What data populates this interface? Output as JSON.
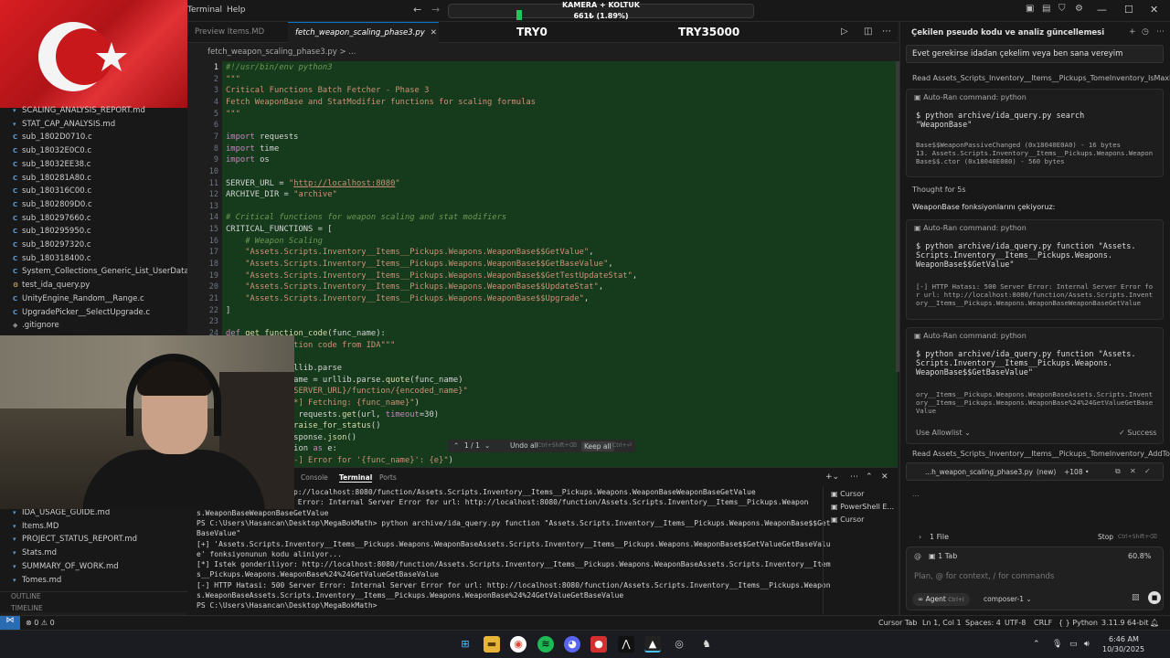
{
  "menu": {
    "terminal": "Terminal",
    "help": "Help"
  },
  "stream": {
    "label": "KAMERA + KOLTUK",
    "stat": "661₺ (1.89%)",
    "try0": "TRY0",
    "try35000": "TRY35000"
  },
  "tabs": {
    "preview": "Preview Items.MD",
    "active": "fetch_weapon_scaling_phase3.py"
  },
  "breadcrumb": "fetch_weapon_scaling_phase3.py  >  ...",
  "explorer": {
    "files_top": [
      {
        "icon": "md",
        "name": "SCALING_ANALYSIS_REPORT.md"
      },
      {
        "icon": "md",
        "name": "STAT_CAP_ANALYSIS.md"
      },
      {
        "icon": "c",
        "name": "sub_1802D0710.c"
      },
      {
        "icon": "c",
        "name": "sub_18032E0C0.c"
      },
      {
        "icon": "c",
        "name": "sub_18032EE38.c"
      },
      {
        "icon": "c",
        "name": "sub_180281A80.c"
      },
      {
        "icon": "c",
        "name": "sub_180316C00.c"
      },
      {
        "icon": "c",
        "name": "sub_1802809D0.c"
      },
      {
        "icon": "c",
        "name": "sub_180297660.c"
      },
      {
        "icon": "c",
        "name": "sub_180295950.c"
      },
      {
        "icon": "c",
        "name": "sub_180297320.c"
      },
      {
        "icon": "c",
        "name": "sub_180318400.c"
      },
      {
        "icon": "c",
        "name": "System_Collections_Generic_List_UserDataSt..."
      },
      {
        "icon": "py",
        "name": "test_ida_query.py"
      },
      {
        "icon": "c",
        "name": "UnityEngine_Random__Range.c"
      },
      {
        "icon": "c",
        "name": "UpgradePicker__SelectUpgrade.c"
      },
      {
        "icon": "git",
        "name": ".gitignore"
      }
    ],
    "files_bottom": [
      {
        "icon": "md",
        "name": "IDA_USAGE_GUIDE.md"
      },
      {
        "icon": "md",
        "name": "Items.MD"
      },
      {
        "icon": "md",
        "name": "PROJECT_STATUS_REPORT.md"
      },
      {
        "icon": "md",
        "name": "Stats.md"
      },
      {
        "icon": "md",
        "name": "SUMMARY_OF_WORK.md"
      },
      {
        "icon": "md",
        "name": "Tomes.md"
      }
    ],
    "outline": "OUTLINE",
    "timeline": "TIMELINE"
  },
  "editor": {
    "lines": [
      {
        "n": "1",
        "html": "<span class='cm'>#!/usr/bin/env python3</span>"
      },
      {
        "n": "2",
        "html": "<span class='st'>\"\"\"</span>"
      },
      {
        "n": "3",
        "html": "<span class='st'>Critical Functions Batch Fetcher - Phase 3</span>"
      },
      {
        "n": "4",
        "html": "<span class='st'>Fetch WeaponBase and StatModifier functions for scaling formulas</span>"
      },
      {
        "n": "5",
        "html": "<span class='st'>\"\"\"</span>"
      },
      {
        "n": "6",
        "html": ""
      },
      {
        "n": "7",
        "html": "<span class='kw'>import</span> requests"
      },
      {
        "n": "8",
        "html": "<span class='kw'>import</span> time"
      },
      {
        "n": "9",
        "html": "<span class='kw'>import</span> os"
      },
      {
        "n": "10",
        "html": ""
      },
      {
        "n": "11",
        "html": "SERVER_URL = <span class='st'>\"</span><span class='url'>http://localhost:8080</span><span class='st'>\"</span>"
      },
      {
        "n": "12",
        "html": "ARCHIVE_DIR = <span class='st'>\"archive\"</span>"
      },
      {
        "n": "13",
        "html": ""
      },
      {
        "n": "14",
        "html": "<span class='cm'># Critical functions for weapon scaling and stat modifiers</span>"
      },
      {
        "n": "15",
        "html": "CRITICAL_FUNCTIONS = ["
      },
      {
        "n": "16",
        "html": "    <span class='cm'># Weapon Scaling</span>"
      },
      {
        "n": "17",
        "html": "    <span class='st'>\"Assets.Scripts.Inventory__Items__Pickups.Weapons.WeaponBase$$GetValue\"</span>,"
      },
      {
        "n": "18",
        "html": "    <span class='st'>\"Assets.Scripts.Inventory__Items__Pickups.Weapons.WeaponBase$$GetBaseValue\"</span>,"
      },
      {
        "n": "19",
        "html": "    <span class='st'>\"Assets.Scripts.Inventory__Items__Pickups.Weapons.WeaponBase$$GetTestUpdateStat\"</span>,"
      },
      {
        "n": "20",
        "html": "    <span class='st'>\"Assets.Scripts.Inventory__Items__Pickups.Weapons.WeaponBase$$UpdateStat\"</span>,"
      },
      {
        "n": "21",
        "html": "    <span class='st'>\"Assets.Scripts.Inventory__Items__Pickups.Weapons.WeaponBase$$Upgrade\"</span>,"
      },
      {
        "n": "22",
        "html": "]"
      },
      {
        "n": "23",
        "html": ""
      },
      {
        "n": "24",
        "html": "<span class='kw'>def</span> <span class='fn'>get_function_code</span>(func_name):"
      },
      {
        "n": "25",
        "html": "             <span class='st'>ction code from IDA\"\"\"</span>"
      },
      {
        "n": "26",
        "html": ""
      },
      {
        "n": "27",
        "html": "             rllib.parse"
      },
      {
        "n": "28",
        "html": "             name = urllib.parse.<span class='fn'>quote</span>(func_name)"
      },
      {
        "n": "29",
        "html": "             <span class='st'>{SERVER_URL}/function/{encoded_name}\"</span>"
      },
      {
        "n": "30",
        "html": "             <span class='st'>[*] Fetching: {func_name}\"</span>)"
      },
      {
        "n": "31",
        "html": "             = requests.<span class='fn'>get</span>(url, <span class='kw'>timeout</span>=30)"
      },
      {
        "n": "32",
        "html": "             .<span class='fn'>raise_for_status</span>()"
      },
      {
        "n": "33",
        "html": "             esponse.<span class='fn'>json</span>()"
      },
      {
        "n": "34",
        "html": "             tion <span class='kw'>as</span> e:"
      },
      {
        "n": "35",
        "html": "             <span class='st'>[-] Error for '{func_name}': {e}\"</span>)"
      }
    ],
    "inline": {
      "count": "1 / 1",
      "undo": "Undo all",
      "undo_hint": "Ctrl+Shift+⌫",
      "keep": "Keep all",
      "keep_hint": "Ctrl+⏎"
    }
  },
  "terminal": {
    "tabs": [
      "Console",
      "Terminal",
      "Ports"
    ],
    "lines": [
      "                    ttp://localhost:8080/function/Assets.Scripts.Inventory__Items__Pickups.Weapons.WeaponBaseWeaponBaseGetValue",
      "                    er Error: Internal Server Error for url: http://localhost:8080/function/Assets.Scripts.Inventory__Items__Pickups.Weapon",
      "s.WeaponBaseWeaponBaseGetValue",
      "PS C:\\Users\\Hasancan\\Desktop\\MegaBokMath> python archive/ida_query.py function \"Assets.Scripts.Inventory__Items__Pickups.Weapons.WeaponBase$$Get",
      "BaseValue\"",
      "[+] 'Assets.Scripts.Inventory__Items__Pickups.Weapons.WeaponBaseAssets.Scripts.Inventory__Items__Pickups.Weapons.WeaponBase$$GetValueGetBaseValu",
      "e' fonksiyonunun kodu aliniyor...",
      "[*] Istek gonderiliyor: http://localhost:8080/function/Assets.Scripts.Inventory__Items__Pickups.Weapons.WeaponBaseAssets.Scripts.Inventory__Item",
      "s__Pickups.Weapons.WeaponBase%24%24GetValueGetBaseValue",
      "[-] HTTP Hatasi: 500 Server Error: Internal Server Error for url: http://localhost:8080/function/Assets.Scripts.Inventory__Items__Pickups.Weapon",
      "s.WeaponBaseAssets.Scripts.Inventory__Items__Pickups.Weapons.WeaponBase%24%24GetValueGetBaseValue",
      "PS C:\\Users\\Hasancan\\Desktop\\MegaBokMath> "
    ],
    "instances": [
      "Cursor",
      "PowerShell E...",
      "Cursor"
    ]
  },
  "ai": {
    "title": "Çekilen pseudo kodu ve analiz güncellemesi",
    "user_msg": "Evet gerekirse idadan çekelim veya ben sana vereyim",
    "read1": "Read Assets_Scripts_Inventory__Items__Pickups_TomeInventory_IsMaxLevel.c",
    "card1": {
      "hdr": "Auto-Ran command: python",
      "cmd": "$ python archive/ida_query.py search\n\"WeaponBase\"",
      "out": "Base$$WeaponPassiveChanged (0x18040E0A0) - 16 bytes\n13. Assets.Scripts.Inventory__Items__Pickups.Weapons.Weapon\nBase$$.ctor (0x18040E080) - 560 bytes"
    },
    "thought": "Thought for 5s",
    "status": "WeaponBase fonksiyonlarını çekiyoruz:",
    "card2": {
      "hdr": "Auto-Ran command: python",
      "cmd": "$ python archive/ida_query.py function \"Assets.\nScripts.Inventory__Items__Pickups.Weapons.\nWeaponBase$$GetValue\"",
      "out": "[-] HTTP Hatası: 500 Server Error: Internal Server Error fo\nr url: http://localhost:8080/function/Assets.Scripts.Invent\nory__Items__Pickups.Weapons.WeaponBaseWeaponBaseGetValue"
    },
    "card3": {
      "hdr": "Auto-Ran command: python",
      "cmd": "$ python archive/ida_query.py function \"Assets.\nScripts.Inventory__Items__Pickups.Weapons.\nWeaponBase$$GetBaseValue\"",
      "out": "ory__Items__Pickups.Weapons.WeaponBaseAssets.Scripts.Invent\nory__Items__Pickups.Weapons.WeaponBase%24%24GetValueGetBase\nValue",
      "allowlist": "Use Allowlist ⌄",
      "success": "✓ Success"
    },
    "read2": "Read Assets_Scripts_Inventory__Items__Pickups_TomeInventory_AddTome.c...",
    "file_card": {
      "name": "...h_weapon_scaling_phase3.py",
      "badge": "(new)",
      "diff": "+108 •"
    },
    "dots": "...",
    "files_row": {
      "label": "1 File",
      "stop": "Stop",
      "stop_hint": "Ctrl+Shift+⌫"
    },
    "input": {
      "tab_label": "1 Tab",
      "zoom": "60.8%",
      "placeholder": "Plan, @ for context, / for commands",
      "agent": "Agent",
      "agent_hint": "Ctrl+I",
      "model": "composer-1 ⌄"
    }
  },
  "statusbar": {
    "errors": "⊗ 0  ⚠ 0",
    "cursor_tab": "Cursor Tab",
    "pos": "Ln 1, Col 1",
    "spaces": "Spaces: 4",
    "enc": "UTF-8",
    "eol": "CRLF",
    "lang": "{ }  Python",
    "py": "3.11.9 64-bit"
  },
  "taskbar": {
    "time": "6:46 AM",
    "date": "10/30/2025"
  },
  "colors": {
    "accent": "#0078d4",
    "editor_highlight": "#163a1c",
    "flag_red": "#d81e22"
  }
}
